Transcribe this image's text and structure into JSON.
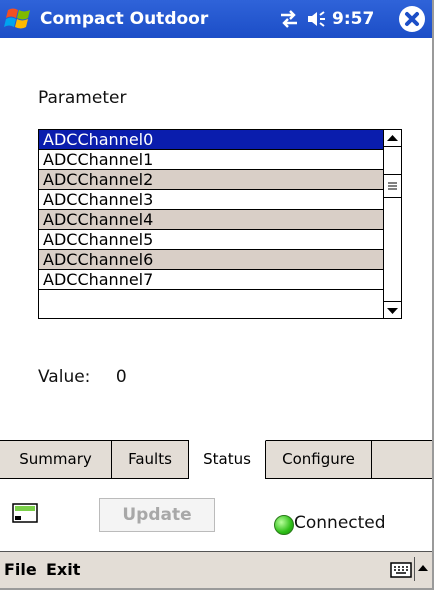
{
  "window": {
    "title": "Compact Outdoor",
    "time": "9:57",
    "icons": [
      "windows-start-icon",
      "connectivity-icon",
      "volume-icon",
      "close-icon"
    ]
  },
  "parameter": {
    "label": "Parameter",
    "selected": "ADCChannel0",
    "items": [
      "ADCChannel0",
      "ADCChannel1",
      "ADCChannel2",
      "ADCChannel3",
      "ADCChannel4",
      "ADCChannel5",
      "ADCChannel6",
      "ADCChannel7"
    ]
  },
  "value": {
    "label": "Value:",
    "text": "0"
  },
  "tabs": [
    {
      "label": "Summary",
      "active": false
    },
    {
      "label": "Faults",
      "active": false
    },
    {
      "label": "Status",
      "active": true
    },
    {
      "label": "Configure",
      "active": false
    }
  ],
  "status": {
    "update_label": "Update",
    "connection_text": "Connected",
    "connection_color": "#2fbf18"
  },
  "menubar": {
    "file_label": "File",
    "exit_label": "Exit"
  },
  "colors": {
    "titlebar": "#1c4ec7",
    "selection": "#0a1dad",
    "alt_row": "#d9cfc7",
    "bar": "#e3ddd6"
  }
}
